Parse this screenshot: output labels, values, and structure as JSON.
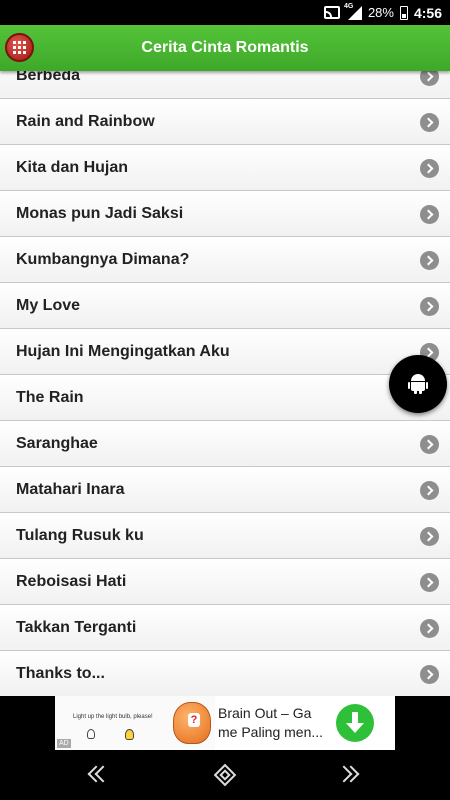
{
  "status": {
    "network": "4G",
    "battery": "28%",
    "time": "4:56"
  },
  "header": {
    "title": "Cerita Cinta Romantis"
  },
  "list": {
    "items": [
      "Berbeda",
      "Rain and Rainbow",
      "Kita dan Hujan",
      "Monas pun Jadi Saksi",
      "Kumbangnya Dimana?",
      "My Love",
      "Hujan Ini Mengingatkan Aku",
      "The Rain",
      "Saranghae",
      "Matahari Inara",
      "Tulang Rusuk ku",
      "Reboisasi Hati",
      "Takkan Terganti",
      "Thanks to..."
    ]
  },
  "ad": {
    "tagline": "Light up the light bulb, please!",
    "badge": "AD",
    "title_line1": "Brain Out – Ga",
    "title_line2": "me Paling men..."
  },
  "colors": {
    "app_bar": "#3ea828",
    "menu_button": "#c0302a",
    "chevron": "#8e8e8e",
    "download": "#2fc03a"
  }
}
